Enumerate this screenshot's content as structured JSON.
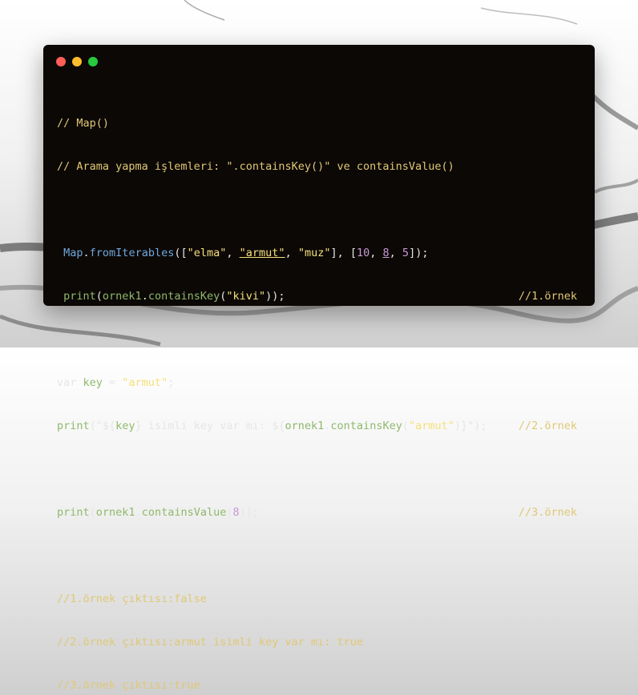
{
  "window_controls": [
    "close",
    "minimize",
    "maximize"
  ],
  "code": {
    "comment_map": "// Map()",
    "comment_search": "// Arama yapma işlemleri: \".containsKey()\" ve containsValue()",
    "l3": {
      "map": "Map",
      "dot": ".",
      "fromIterables": "fromIterables",
      "open": "([",
      "elma": "\"elma\"",
      "comma1": ", ",
      "armut": "\"armut\"",
      "comma2": ", ",
      "muz": "\"muz\"",
      "mid": "], [",
      "n10": "10",
      "comma3": ", ",
      "n8": "8",
      "comma4": ", ",
      "n5": "5",
      "close": "]);"
    },
    "l4": {
      "print": "print",
      "open": "(",
      "ornek1": "ornek1",
      "dot": ".",
      "containsKey": "containsKey",
      "open2": "(",
      "kivi": "\"kivi\"",
      "close": "));",
      "comment": "//1.örnek"
    },
    "l5": {
      "var": "var ",
      "key": "key",
      "eq": " = ",
      "armut": "\"armut\"",
      "semi": ";"
    },
    "l6": {
      "print": "print",
      "open": "(",
      "str1": "\"${",
      "key": "key",
      "str2": "} isimli key var mı: ${",
      "ornek1": "ornek1",
      "dot": ".",
      "containsKey": "containsKey",
      "open2": "(",
      "armut": "\"armut\"",
      "close_inner": ")",
      "str3": "}\"",
      "close": ");",
      "comment": "//2.örnek"
    },
    "l7": {
      "print": "print",
      "open": "(",
      "ornek1": "ornek1",
      "dot": ".",
      "containsValue": "containsValue",
      "open2": "(",
      "n8": "8",
      "close": "));",
      "comment": "//3.örnek"
    },
    "out1": "//1.örnek çıktısı:false",
    "out2": "//2.örnek çıktısı:armut isimli key var mı: true",
    "out3": "//3.örnek çıktısı:true"
  }
}
